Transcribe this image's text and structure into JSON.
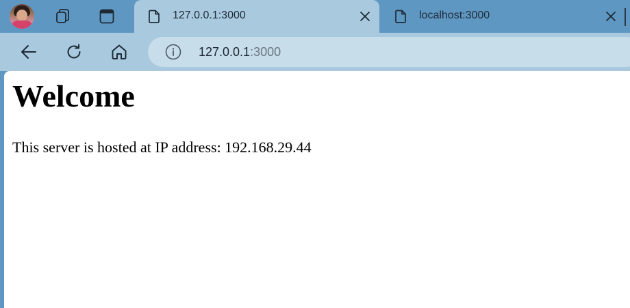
{
  "browser": {
    "tabs": [
      {
        "title": "127.0.0.1:3000",
        "active": true
      },
      {
        "title": "localhost:3000",
        "active": false
      }
    ],
    "address_bar": {
      "host": "127.0.0.1",
      "port": ":3000"
    },
    "icons": {
      "profile": "profile-avatar",
      "workspaces": "workspaces-icon",
      "tab_actions": "tab-actions-icon",
      "page": "page-icon",
      "close": "close-icon",
      "back": "back-arrow-icon",
      "refresh": "refresh-icon",
      "home": "home-icon",
      "site_info": "info-icon"
    },
    "colors": {
      "tab_strip": "#5f97c3",
      "active_tab": "#a9c9de",
      "address_bar": "#c7dde9",
      "page_background": "#ffffff"
    }
  },
  "page": {
    "heading": "Welcome",
    "body_text": "This server is hosted at IP address: 192.168.29.44"
  }
}
